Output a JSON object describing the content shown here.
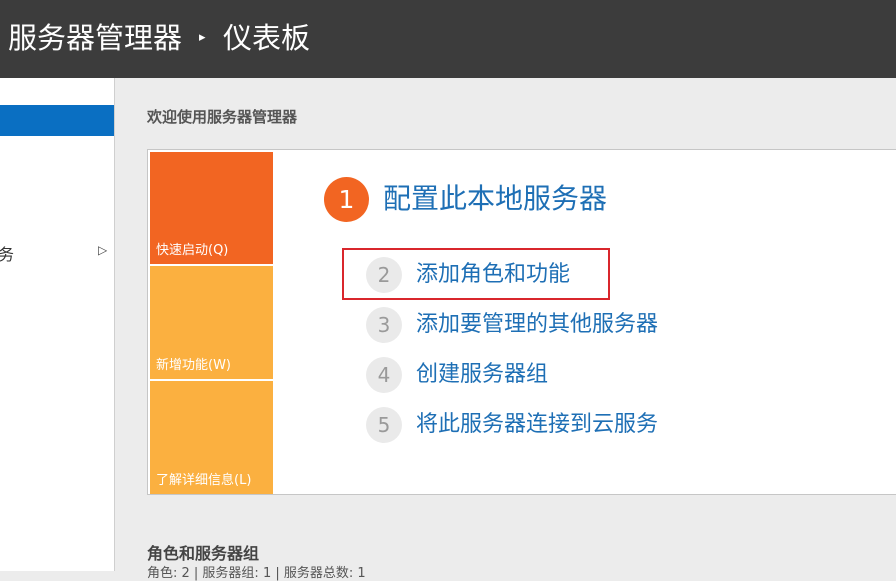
{
  "titlebar": {
    "app_title": "服务器管理器",
    "separator": "▸",
    "page_title": "仪表板"
  },
  "sidebar": {
    "items": [
      {
        "label": "",
        "selected": true
      },
      {
        "label": "务",
        "chevron": "▷"
      }
    ]
  },
  "main": {
    "welcome_heading": "欢迎使用服务器管理器",
    "tiles": [
      {
        "label": "快速启动(Q)"
      },
      {
        "label": "新增功能(W)"
      },
      {
        "label": "了解详细信息(L)"
      }
    ],
    "step1": {
      "number": "1",
      "label": "配置此本地服务器"
    },
    "steps": [
      {
        "number": "2",
        "label": "添加角色和功能",
        "highlighted": true
      },
      {
        "number": "3",
        "label": "添加要管理的其他服务器"
      },
      {
        "number": "4",
        "label": "创建服务器组"
      },
      {
        "number": "5",
        "label": "将此服务器连接到云服务"
      }
    ],
    "roles_heading": "角色和服务器组",
    "roles_summary": "角色: 2 | 服务器组: 1 | 服务器总数: 1"
  },
  "colors": {
    "titlebar_bg": "#3c3c3c",
    "accent_blue": "#0a6fc2",
    "link_blue": "#1e6fb5",
    "tile_orange": "#f26522",
    "tile_amber": "#fbb040",
    "highlight_red": "#d9262c"
  }
}
